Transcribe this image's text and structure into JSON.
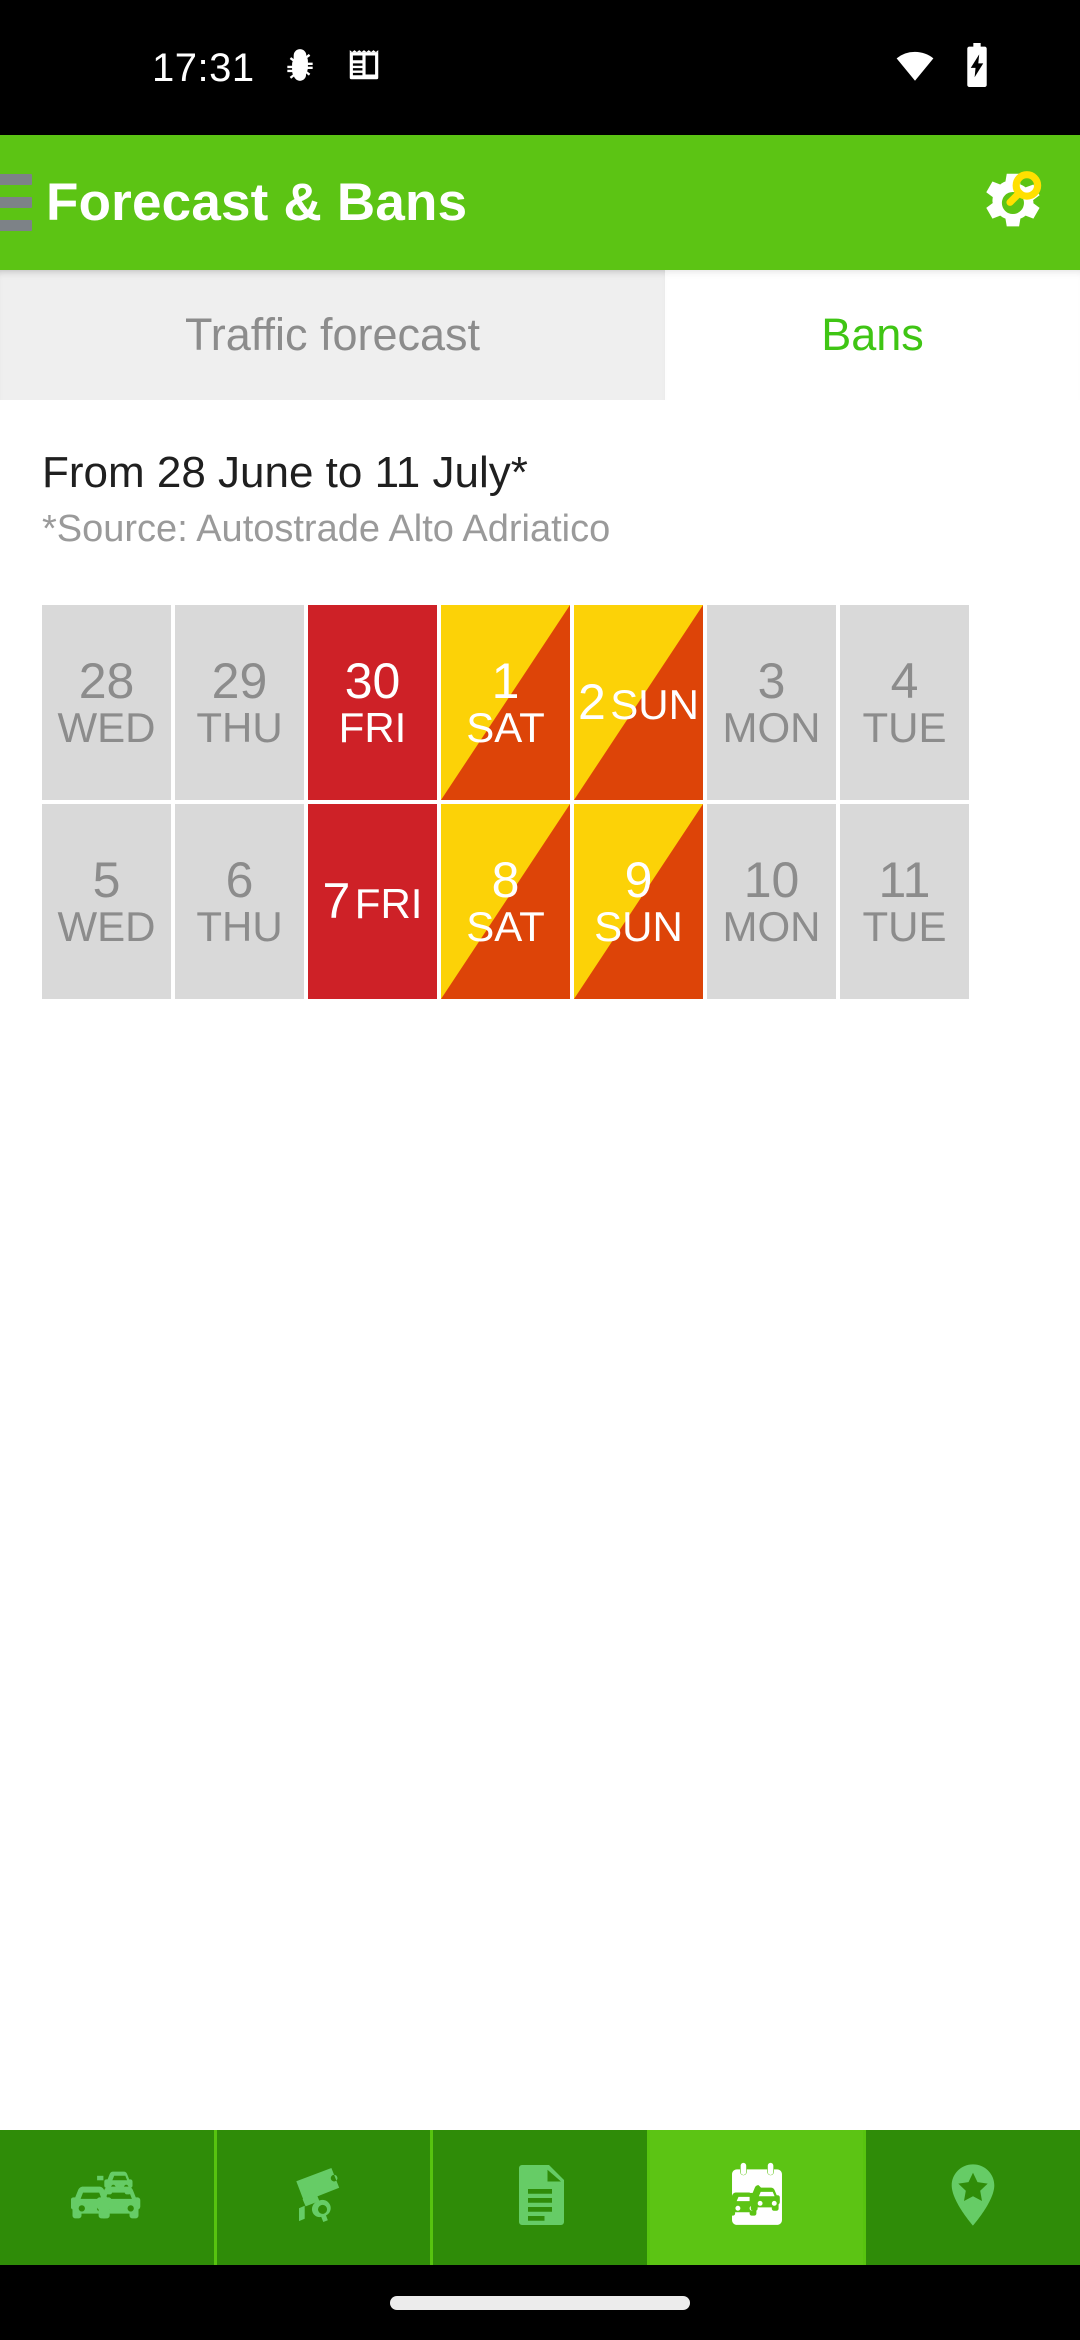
{
  "status_bar": {
    "time": "17:31",
    "icons_left": [
      "bug-icon",
      "news-icon"
    ],
    "icons_right": [
      "wifi-icon",
      "battery-charging-icon"
    ],
    "background": "#000000"
  },
  "app_bar": {
    "title": "Forecast & Bans",
    "menu_icon": "hamburger-menu-icon",
    "action_icon": "settings-gear-search-icon",
    "background": "#5CC414",
    "title_color": "#FFFFFF"
  },
  "tabs": [
    {
      "label": "Traffic forecast",
      "active": false
    },
    {
      "label": "Bans",
      "active": true
    }
  ],
  "header": {
    "range": "From 28 June to 11 July*",
    "source": "*Source: Autostrade Alto Adriatico"
  },
  "legend_colors": {
    "free": "#D9D9D9",
    "free_text": "#8C8C8C",
    "ban": "#CE2127",
    "partial_top": "#FCD207",
    "partial_bottom": "#DD4408",
    "active_tab": "#3FC514"
  },
  "calendar": {
    "days": [
      {
        "num": "28",
        "dow": "WED",
        "state": "free",
        "inline": false
      },
      {
        "num": "29",
        "dow": "THU",
        "state": "free",
        "inline": false
      },
      {
        "num": "30",
        "dow": "FRI",
        "state": "ban",
        "inline": false
      },
      {
        "num": "1",
        "dow": "SAT",
        "state": "partial",
        "inline": false
      },
      {
        "num": "2",
        "dow": "SUN",
        "state": "partial",
        "inline": true
      },
      {
        "num": "3",
        "dow": "MON",
        "state": "free",
        "inline": false
      },
      {
        "num": "4",
        "dow": "TUE",
        "state": "free",
        "inline": false
      },
      {
        "num": "5",
        "dow": "WED",
        "state": "free",
        "inline": false
      },
      {
        "num": "6",
        "dow": "THU",
        "state": "free",
        "inline": false
      },
      {
        "num": "7",
        "dow": "FRI",
        "state": "ban",
        "inline": true
      },
      {
        "num": "8",
        "dow": "SAT",
        "state": "partial",
        "inline": false
      },
      {
        "num": "9",
        "dow": "SUN",
        "state": "partial",
        "inline": false
      },
      {
        "num": "10",
        "dow": "MON",
        "state": "free",
        "inline": false
      },
      {
        "num": "11",
        "dow": "TUE",
        "state": "free",
        "inline": false
      }
    ]
  },
  "bottom_nav": {
    "background": "#2F8C08",
    "active_background": "#5CC414",
    "items": [
      {
        "icon": "traffic-cars-icon",
        "active": false
      },
      {
        "icon": "traffic-camera-icon",
        "active": false
      },
      {
        "icon": "document-icon",
        "active": false
      },
      {
        "icon": "calendar-car-icon",
        "active": true
      },
      {
        "icon": "map-pin-star-icon",
        "active": false
      }
    ]
  },
  "gesture_bar": {
    "pill": "home-gesture-pill"
  }
}
